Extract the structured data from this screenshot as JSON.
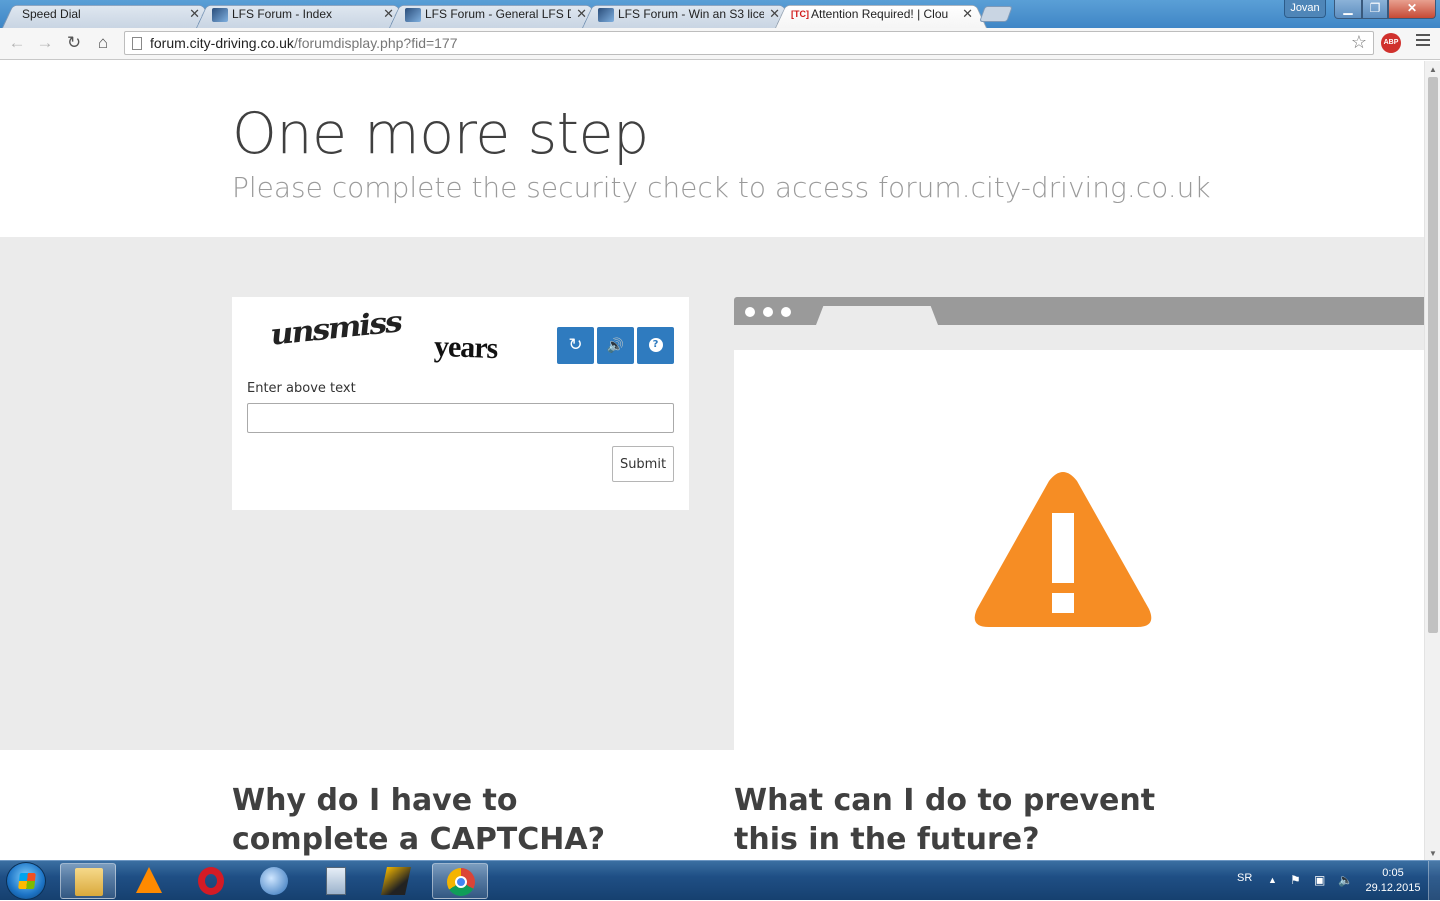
{
  "browser": {
    "tabs": [
      {
        "title": "Speed Dial",
        "favicon": "none",
        "active": false
      },
      {
        "title": "LFS Forum - Index",
        "favicon": "lfs-favicon",
        "active": false
      },
      {
        "title": "LFS Forum - General LFS D",
        "favicon": "lfs-favicon",
        "active": false
      },
      {
        "title": "LFS Forum - Win an S3 lice",
        "favicon": "lfs-favicon",
        "active": false
      },
      {
        "title": "Attention Required! | Clou",
        "favicon": "cloudflare-favicon",
        "favicon_text": "[TC]",
        "active": true
      }
    ],
    "user_badge": "Jovan",
    "window_controls": {
      "minimize": "▁",
      "maximize": "❐",
      "close": "✕"
    },
    "nav": {
      "back": "←",
      "forward": "→",
      "reload": "↻",
      "home": "⌂"
    },
    "url_host": "forum.city-driving.co.uk",
    "url_path": "/forumdisplay.php?fid=177",
    "bookmark_star": "☆",
    "adblock_label": "ABP"
  },
  "page": {
    "heading": "One more step",
    "subheading": "Please complete the security check to access forum.city-driving.co.uk",
    "captcha": {
      "word_1": "unsmiss",
      "word_2": "years",
      "reload_icon": "↻",
      "audio_icon": "🔊",
      "help_icon": "?",
      "label": "Enter above text",
      "input_value": "",
      "submit_label": "Submit"
    },
    "illustration": {
      "icon": "warning-triangle-icon",
      "color": "#f68d24"
    },
    "why_heading": "Why do I have to complete a CAPTCHA?",
    "prevent_heading": "What can I do to prevent this in the future?"
  },
  "taskbar": {
    "apps": [
      "explorer",
      "vlc",
      "opera",
      "thunderbird",
      "calculator",
      "winamp",
      "chrome"
    ],
    "active_app": "chrome",
    "language": "SR",
    "tray_icons": [
      "▲",
      "⚑",
      "▣",
      "🔈"
    ],
    "time": "0:05",
    "date": "29.12.2015"
  },
  "colors": {
    "accent_blue": "#2f7bbf",
    "warning_orange": "#f68d24",
    "band_grey": "#ebebeb"
  }
}
